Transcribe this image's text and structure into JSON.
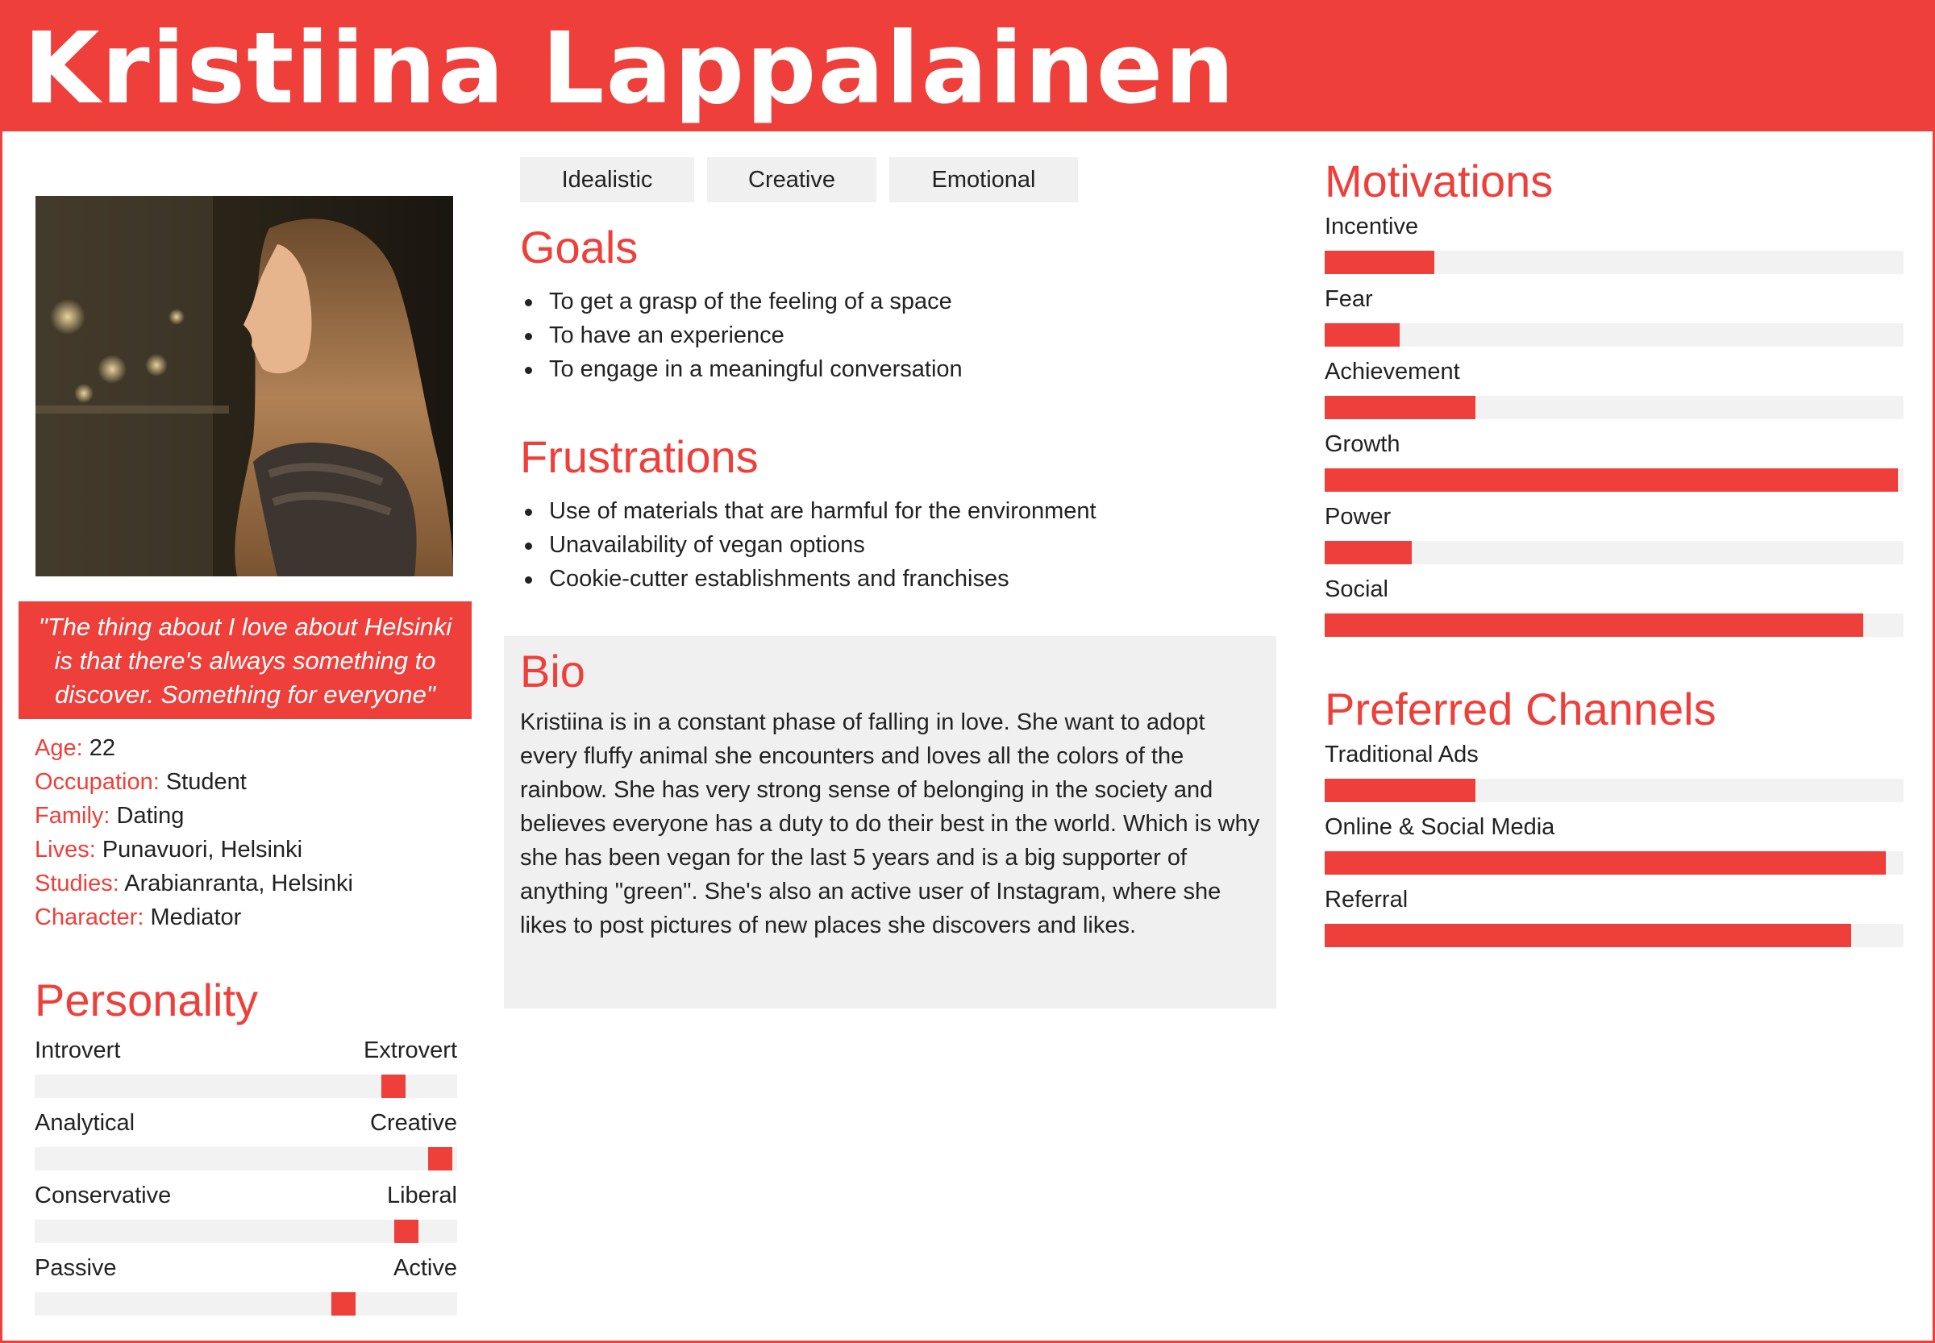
{
  "persona": {
    "name": "Kristiina Lappalainen",
    "quote": "\"The thing about I love about Helsinki is that there's always something to discover. Something for everyone\""
  },
  "facts": [
    {
      "key": "Age:",
      "value": "22"
    },
    {
      "key": "Occupation:",
      "value": "Student"
    },
    {
      "key": "Family:",
      "value": "Dating"
    },
    {
      "key": "Lives:",
      "value": "Punavuori, Helsinki"
    },
    {
      "key": "Studies:",
      "value": "Arabianranta, Helsinki"
    },
    {
      "key": "Character:",
      "value": "Mediator"
    }
  ],
  "personality": {
    "title": "Personality",
    "sliders": [
      {
        "left": "Introvert",
        "right": "Extrovert",
        "level": 0.85
      },
      {
        "left": "Analytical",
        "right": "Creative",
        "level": 0.96
      },
      {
        "left": "Conservative",
        "right": "Liberal",
        "level": 0.88
      },
      {
        "left": "Passive",
        "right": "Active",
        "level": 0.73
      }
    ]
  },
  "tags": [
    "Idealistic",
    "Creative",
    "Emotional"
  ],
  "goals": {
    "title": "Goals",
    "items": [
      "To get a grasp of the feeling of a space",
      "To have an experience",
      "To engage in a meaningful conversation"
    ]
  },
  "frustrations": {
    "title": "Frustrations",
    "items": [
      "Use of materials that are harmful for the environment",
      "Unavailability of vegan options",
      "Cookie-cutter establishments and franchises"
    ]
  },
  "bio": {
    "title": "Bio",
    "text": "Kristiina is in a constant phase of falling in love. She want to adopt every fluffy animal she encounters and loves all the colors of the rainbow. She has very strong sense of belonging in the society and believes everyone has a duty to do their best in the world. Which is why she has been vegan for the last 5 years and is a big supporter of anything \"green\". She's also an active user of Instagram, where she likes to post pictures of new places she discovers and likes."
  },
  "motivations": {
    "title": "Motivations",
    "items": [
      {
        "label": "Incentive",
        "level": 0.19
      },
      {
        "label": "Fear",
        "level": 0.13
      },
      {
        "label": "Achievement",
        "level": 0.26
      },
      {
        "label": "Growth",
        "level": 0.99
      },
      {
        "label": "Power",
        "level": 0.15
      },
      {
        "label": "Social",
        "level": 0.93
      }
    ]
  },
  "channels": {
    "title": "Preferred Channels",
    "items": [
      {
        "label": "Traditional Ads",
        "level": 0.26
      },
      {
        "label": "Online & Social Media",
        "level": 0.97
      },
      {
        "label": "Referral",
        "level": 0.91
      }
    ]
  },
  "colors": {
    "accent": "#ef3f3a",
    "track": "#f2f2f2",
    "panel": "#f0f0f0"
  }
}
